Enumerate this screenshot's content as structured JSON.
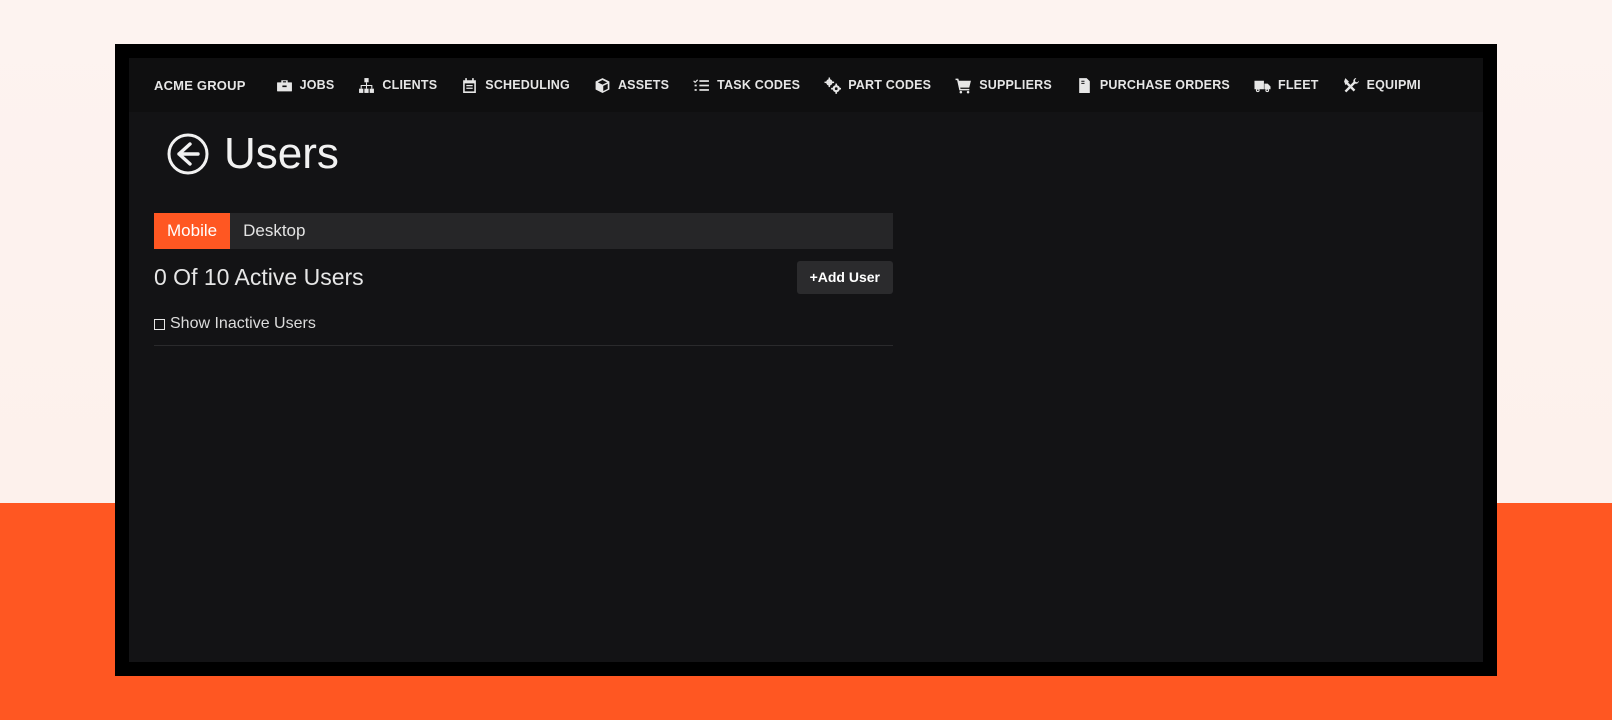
{
  "nav": {
    "brand": "ACME GROUP",
    "items": [
      {
        "label": "JOBS",
        "icon": "briefcase-icon"
      },
      {
        "label": "CLIENTS",
        "icon": "sitemap-icon"
      },
      {
        "label": "SCHEDULING",
        "icon": "calendar-icon"
      },
      {
        "label": "ASSETS",
        "icon": "cube-icon"
      },
      {
        "label": "TASK CODES",
        "icon": "tasks-icon"
      },
      {
        "label": "PART CODES",
        "icon": "gears-icon"
      },
      {
        "label": "SUPPLIERS",
        "icon": "cart-icon"
      },
      {
        "label": "PURCHASE ORDERS",
        "icon": "invoice-icon"
      },
      {
        "label": "FLEET",
        "icon": "truck-icon"
      },
      {
        "label": "EQUIPMI",
        "icon": "tools-icon"
      }
    ]
  },
  "page": {
    "title": "Users",
    "back_icon": "back-arrow-icon"
  },
  "tabs": [
    {
      "label": "Mobile",
      "active": true
    },
    {
      "label": "Desktop",
      "active": false
    }
  ],
  "users": {
    "count_text": "0 Of 10 Active Users",
    "add_button": "+Add User",
    "show_inactive_label": "Show Inactive Users",
    "show_inactive_checked": false
  },
  "colors": {
    "accent": "#ff5722",
    "background": "#131315",
    "nav_background": "#0f0f10",
    "tab_bar": "#262628"
  }
}
